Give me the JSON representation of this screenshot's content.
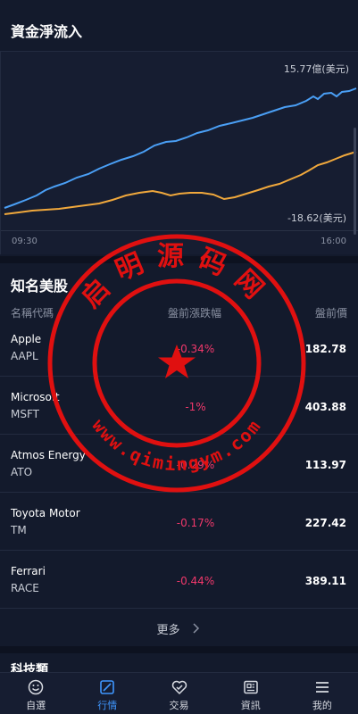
{
  "capital_flow": {
    "title": "資金淨流入",
    "top_value": "15.77億(美元)",
    "bottom_value": "-18.62(美元)",
    "time_start": "09:30",
    "time_end": "16:00",
    "colors": {
      "line_blue": "#4a9ff5",
      "line_orange": "#f0a83c"
    }
  },
  "stocks": {
    "title": "知名美股",
    "columns": {
      "name": "名稱代碼",
      "change": "盤前漲跌幅",
      "price": "盤前價"
    },
    "rows": [
      {
        "name": "Apple",
        "code": "AAPL",
        "change": "-0.34%",
        "price": "182.78"
      },
      {
        "name": "Microsoft",
        "code": "MSFT",
        "change": "-1%",
        "price": "403.88"
      },
      {
        "name": "Atmos Energy",
        "code": "ATO",
        "change": "-0.29%",
        "price": "113.97"
      },
      {
        "name": "Toyota Motor",
        "code": "TM",
        "change": "-0.17%",
        "price": "227.42"
      },
      {
        "name": "Ferrari",
        "code": "RACE",
        "change": "-0.44%",
        "price": "389.11"
      }
    ],
    "more_label": "更多",
    "negative_color": "#f0386b"
  },
  "tech_section": {
    "title": "科技類"
  },
  "bottom_nav": {
    "items": [
      {
        "label": "自選",
        "icon": "smiley-icon",
        "active": false
      },
      {
        "label": "行情",
        "icon": "chart-box-icon",
        "active": true
      },
      {
        "label": "交易",
        "icon": "handshake-heart-icon",
        "active": false
      },
      {
        "label": "資訊",
        "icon": "news-icon",
        "active": false
      },
      {
        "label": "我的",
        "icon": "menu-icon",
        "active": false
      }
    ],
    "active_color": "#3f97ff"
  },
  "watermark": {
    "top_text": "启明源码网",
    "bottom_text": "www.qimingym.com",
    "color": "#e01010"
  }
}
